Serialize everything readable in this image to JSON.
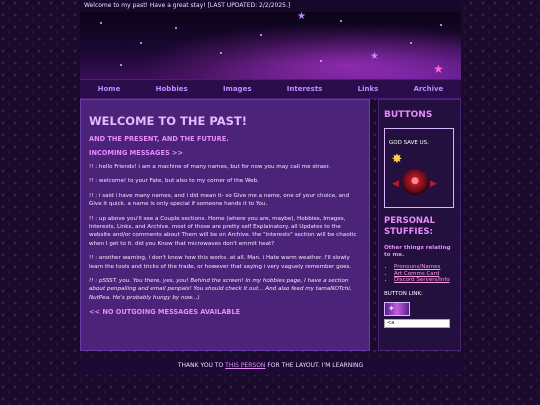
{
  "marquee": "Welcome to my past! Have a great stay! [LAST UPDATED: 2/2/2025.]",
  "nav": [
    "Home",
    "Hobbies",
    "Images",
    "Interests",
    "Links",
    "Archive"
  ],
  "main": {
    "title": "WELCOME TO THE PAST!",
    "subtitle": "AND THE PRESENT, AND THE FUTURE.",
    "incoming": "INCOMING MESSAGES >>",
    "messages": [
      "!! : hello Friends! i am a machine of many names, but for now you may call me straer.",
      "!! : welcome! to your Fate, but also to my corner of the Web.",
      "!! : i said i have many names, and i did mean it- so Give me a name, one of your choice, and Give it quick. a name is only special if someone hands it to You.",
      "!! : up above you'll see a Couple sections. Home (where you are, maybe), Hobbies, Images, Interests, Links, and Archive. most of those are pretty self Explainatory. all Updates to the website and/or comments about Them will be on Archive. the \"interests\" section will be chaotic when I get to it. did you Know that microwaves don't emmit heat?",
      "!! : another warning, i don't know how this works. at all. Man. i Hate warm weather. I'll slowly learn the tools and tricks of the trade, or however that saying i very vaguely remember goes.",
      "!! : pSSST. you. You there, yes, you! Behind the screen! In my hobbies page, I have a section about penpalling and email penpals! You should check it out... And also feed my tamaNOTchi, NutPea. He's probably hungy by now...)"
    ],
    "outgoing": "<< NO OUTGOING MESSAGES AVAILABLE"
  },
  "side": {
    "buttons_title": "BUTTONS",
    "god_save_us": "GOD SAVE US.",
    "personal_title": "PERSONAL STUFFIES:",
    "other_things": "Other things relating to me.",
    "links": [
      "Pronouns/Names",
      "Art Comms Card",
      "Discord Servers/Info"
    ],
    "button_link_label": "BUTTON LINK:",
    "button_code": "<a"
  },
  "footer": {
    "prefix": "THANK YOU TO",
    "link": "THIS PERSON",
    "suffix": "FOR THE LAYOUT. I'M LEARNING"
  },
  "colors": {
    "background": "#1a0b2b",
    "main_panel": "#4b2479",
    "accent_pink": "#e58cff",
    "nav_link": "#c08cff"
  }
}
